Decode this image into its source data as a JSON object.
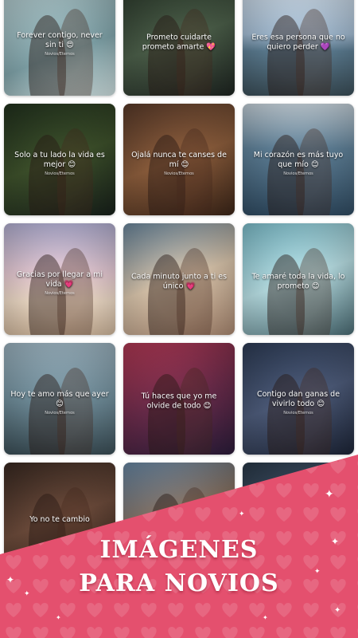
{
  "cards": [
    {
      "caption": "Forever contigo, never sin ti 😍",
      "watermark": "Novios/Eternos",
      "bg": "linear-gradient(160deg,#b9d0d3,#7fa2a8 60%,#cfe0e0)"
    },
    {
      "caption": "Prometo cuidarte prometo amarte 💖",
      "watermark": "",
      "bg": "linear-gradient(160deg,#2c3a2c,#4a5d48 50%,#1d2420)"
    },
    {
      "caption": "Eres esa persona que no quiero perder 💜",
      "watermark": "",
      "bg": "linear-gradient(180deg,#d6e3ef,#9eb6cc 45%,#5a7a8f 60%,#3a4d57)"
    },
    {
      "caption": "Solo a tu lado la vida es mejor 😊",
      "watermark": "Novios/Eternos",
      "bg": "linear-gradient(160deg,#22321e,#3c4f2a 50%,#17201a)"
    },
    {
      "caption": "Ojalá nunca te canses de mí 😊",
      "watermark": "Novios/Eternos",
      "bg": "linear-gradient(160deg,#5a3b2a,#8a5c3b 50%,#3b2518)"
    },
    {
      "caption": "Mi corazón es más tuyo que mío 😊",
      "watermark": "Novios/Eternos",
      "bg": "linear-gradient(180deg,#c9d6df,#5e7f96 40%,#2f4a60)"
    },
    {
      "caption": "Gracias por llegar a mi vida 💗",
      "watermark": "Novios/Eternos",
      "bg": "linear-gradient(180deg,#b6b3d6,#e3c7d0 45%,#e9d6c2 70%,#cdb59b)"
    },
    {
      "caption": "Cada minuto junto a ti es único 💗",
      "watermark": "",
      "bg": "linear-gradient(160deg,#6d8aa0,#d6c2a9 50%,#a88770)"
    },
    {
      "caption": "Te amaré toda la vida, lo prometo 😊",
      "watermark": "",
      "bg": "linear-gradient(160deg,#7fc2d0,#b5dbe0 50%,#4a6b73)"
    },
    {
      "caption": "Hoy te amo más que ayer 😊",
      "watermark": "Novios/Eternos",
      "bg": "linear-gradient(180deg,#9fb7c4,#6f8c99 50%,#3a4d55)"
    },
    {
      "caption": "Tú haces que yo me olvide de todo 😊",
      "watermark": "",
      "bg": "linear-gradient(160deg,#b53a56,#6a2b4a 50%,#2b1c3a)"
    },
    {
      "caption": "Contigo dan ganas de vivirlo todo 😊",
      "watermark": "Novios/Eternos",
      "bg": "linear-gradient(160deg,#2e3d57,#4c5a78 50%,#1c2436)"
    },
    {
      "caption": "Yo no te cambio",
      "watermark": "",
      "bg": "linear-gradient(160deg,#3a2a22,#6b4a3a 50%,#2a1c16)"
    },
    {
      "caption": "",
      "watermark": "",
      "bg": "linear-gradient(160deg,#6a8aa8,#8a6e58 50%,#3b2a22)"
    },
    {
      "caption": "",
      "watermark": "",
      "bg": "linear-gradient(160deg,#2a3a4a,#44546a 50%,#1a2430)"
    }
  ],
  "banner": {
    "line1": "IMÁGENES",
    "line2": "PARA NOVIOS",
    "color": "#e4506e"
  }
}
